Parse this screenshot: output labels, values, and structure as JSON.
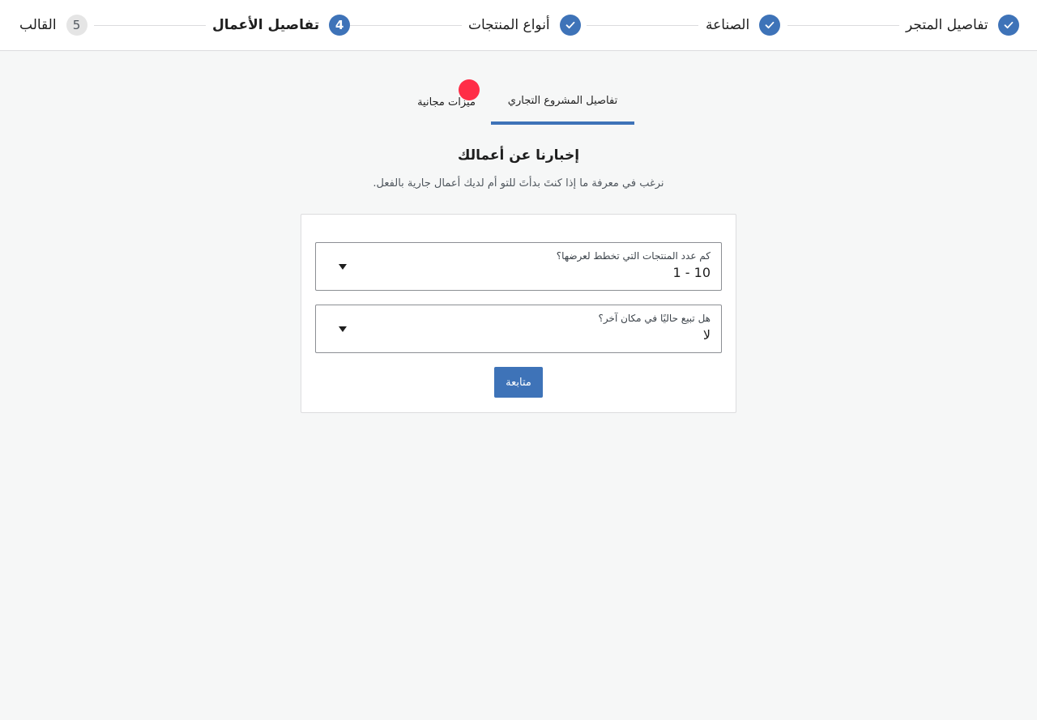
{
  "stepper": {
    "steps": [
      {
        "label": "تفاصيل المتجر",
        "state": "done"
      },
      {
        "label": "الصناعة",
        "state": "done"
      },
      {
        "label": "أنواع المنتجات",
        "state": "done"
      },
      {
        "label": "تفاصيل الأعمال",
        "state": "active",
        "number": "4"
      },
      {
        "label": "القالب",
        "state": "pending",
        "number": "5"
      }
    ]
  },
  "tabs": [
    {
      "label": "تفاصيل المشروع التجاري",
      "active": true
    },
    {
      "label": "ميزات مجانية",
      "active": false,
      "badge_color": "#ff2d47"
    }
  ],
  "main": {
    "heading": "إخبارنا عن أعمالك",
    "subheading": "نرغب في معرفة ما إذا كنتَ بدأتَ للتو أم لديك أعمال جارية بالفعل."
  },
  "form": {
    "fields": [
      {
        "label": "كم عدد المنتجات التي تخطط لعرضها؟",
        "value": "1 - 10"
      },
      {
        "label": "هل تبيع حاليًا في مكان آخر؟",
        "value": "لا"
      }
    ],
    "continue_label": "متابعة"
  },
  "colors": {
    "accent": "#3e73b8",
    "badge": "#ff2d47",
    "background": "#f6f7f7"
  }
}
